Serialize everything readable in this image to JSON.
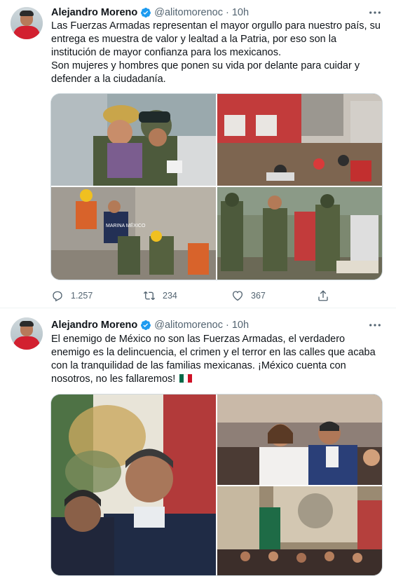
{
  "tweets": [
    {
      "author": "Alejandro Moreno",
      "handle": "@alitomorenoc",
      "separator": "·",
      "time": "10h",
      "text_lines": [
        "Las Fuerzas Armadas representan el mayor orgullo para nuestro país, su entrega es muestra de valor y lealtad a la Patria, por eso son la institución de mayor confianza para los mexicanos.",
        "Son mujeres y hombres que ponen su vida por delante para cuidar y defender a la ciudadanía."
      ],
      "replies": "1.257",
      "retweets": "234",
      "likes": "367"
    },
    {
      "author": "Alejandro Moreno",
      "handle": "@alitomorenoc",
      "separator": "·",
      "time": "10h",
      "text": "El enemigo de México no son las Fuerzas Armadas, el verdadero enemigo es la delincuencia, el crimen y el terror en las calles que acaba con la tranquilidad de las familias mexicanas. ¡México cuenta con nosotros, no les fallaremos!"
    }
  ],
  "icons": {
    "verified": "verified-badge-icon",
    "more": "more-options-icon",
    "reply": "reply-icon",
    "retweet": "retweet-icon",
    "like": "like-icon",
    "share": "share-icon",
    "flag": "mexico-flag-emoji"
  },
  "photo_labels": {
    "marina_vest": "MARINA MÉXICO"
  },
  "colors": {
    "verified_blue": "#1d9bf0",
    "secondary_text": "#536471",
    "divider": "#eff3f4"
  }
}
